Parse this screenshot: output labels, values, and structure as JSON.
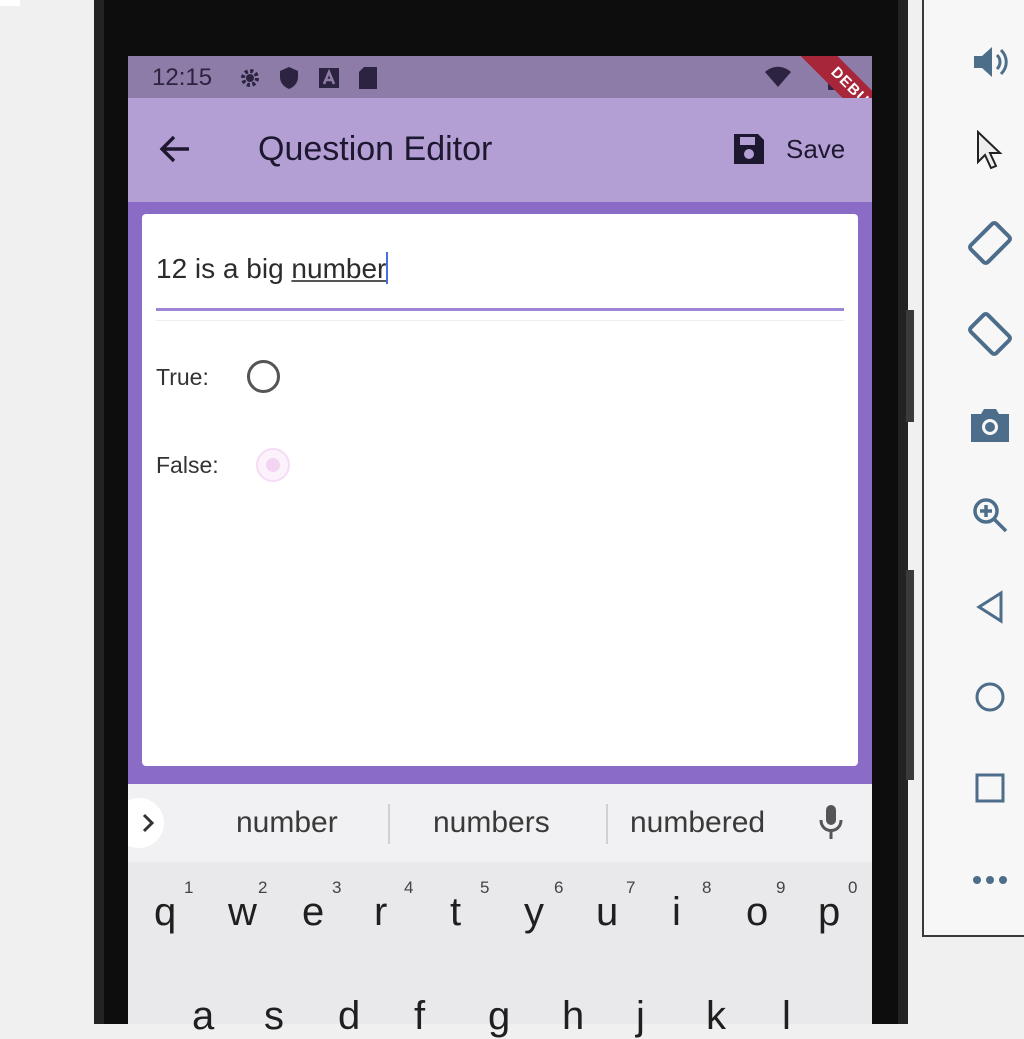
{
  "status_bar": {
    "time": "12:15",
    "debug_banner": "DEBUG"
  },
  "app_bar": {
    "title": "Question Editor",
    "save_label": "Save"
  },
  "editor": {
    "question_value": "12 is a big number",
    "question_prefix": "12 is a big ",
    "question_suffix": "number",
    "true_label": "True:",
    "false_label": "False:",
    "selected_answer": "False"
  },
  "keyboard": {
    "suggestions": [
      "number",
      "numbers",
      "numbered"
    ],
    "row1_keys": [
      "q",
      "w",
      "e",
      "r",
      "t",
      "y",
      "u",
      "i",
      "o",
      "p"
    ],
    "row1_hints": [
      "1",
      "2",
      "3",
      "4",
      "5",
      "6",
      "7",
      "8",
      "9",
      "0"
    ],
    "row2_keys": [
      "a",
      "s",
      "d",
      "f",
      "g",
      "h",
      "j",
      "k",
      "l"
    ]
  },
  "emulator_toolbar": {
    "icons": [
      "volume-up-icon",
      "volume-down-icon",
      "rotate-left-icon",
      "rotate-right-icon",
      "camera-icon",
      "zoom-icon",
      "back-icon",
      "home-icon",
      "overview-icon",
      "more-icon"
    ]
  },
  "colors": {
    "app_bar": "#b39fd3",
    "status_bar": "#8d7ca8",
    "body_background": "#8a6cc6",
    "accent": "#7b5ec4"
  }
}
